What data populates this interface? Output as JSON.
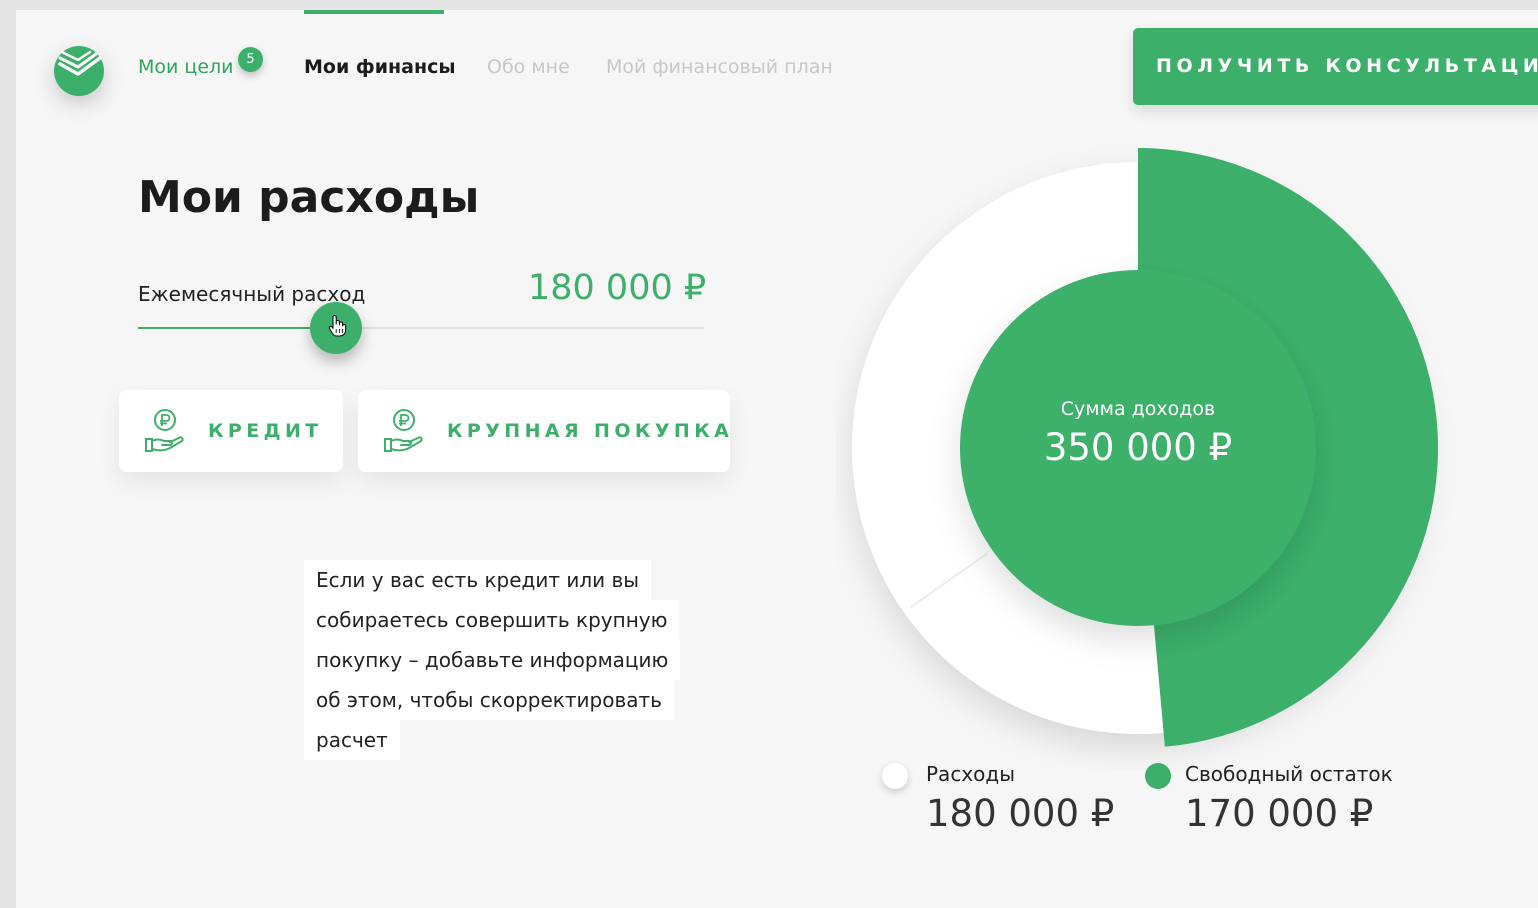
{
  "nav": {
    "items": [
      {
        "label": "Мои цели",
        "state": "link-green"
      },
      {
        "label": "Мои финансы",
        "state": "active"
      },
      {
        "label": "Обо мне",
        "state": "muted"
      },
      {
        "label": "Мой финансовый план",
        "state": "muted"
      }
    ],
    "goals_badge": "5"
  },
  "header": {
    "cta_label": "ПОЛУЧИТЬ КОНСУЛЬТАЦИЮ"
  },
  "main": {
    "title": "Мои расходы",
    "slider": {
      "label": "Ежемесячный расход",
      "value": "180 000 ₽",
      "level": 0.35
    },
    "tiles": [
      {
        "label": "КРЕДИТ",
        "icon": "ruble-hand-icon"
      },
      {
        "label": "КРУПНАЯ ПОКУПКА",
        "icon": "ruble-hand-icon"
      }
    ],
    "hint_lines": [
      "Если у вас есть кредит или вы",
      "собираетесь совершить крупную",
      "покупку – добавьте информацию",
      "об этом, чтобы скорректировать",
      "расчет"
    ]
  },
  "chart_data": {
    "type": "pie",
    "center_title": "Сумма доходов",
    "center_value": "350 000 ₽",
    "total": 350000,
    "slices": [
      {
        "label": "Расходы",
        "value": 180000,
        "display": "180 000 ₽",
        "color": "#ffffff"
      },
      {
        "label": "Свободный остаток",
        "value": 170000,
        "display": "170 000 ₽",
        "color": "#3cb06b"
      }
    ]
  },
  "colors": {
    "accent": "#3cb06b",
    "background": "#f6f6f6",
    "muted_text": "#c7c7c7"
  }
}
